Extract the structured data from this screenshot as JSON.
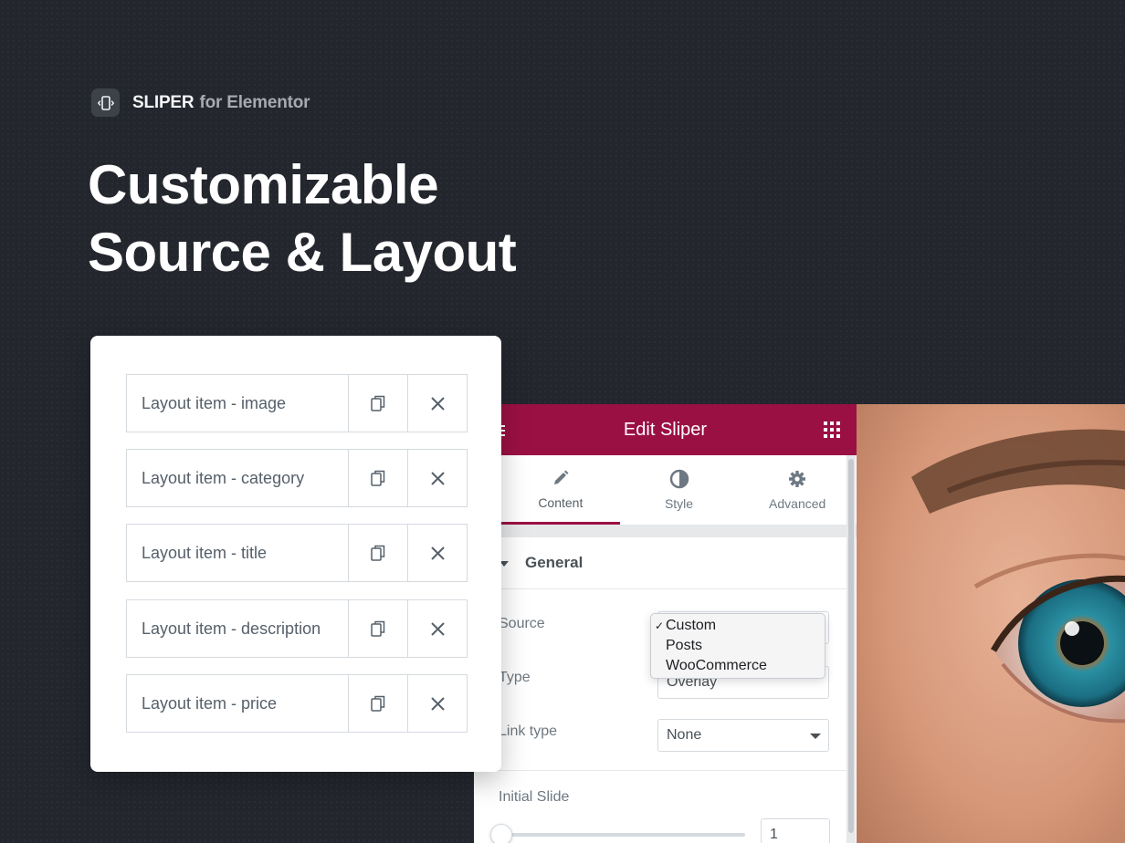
{
  "brand": {
    "name": "SLIPER",
    "suffix": "for Elementor"
  },
  "headline": {
    "line1": "Customizable",
    "line2": "Source & Layout"
  },
  "layout_items": [
    {
      "label": "Layout item - image"
    },
    {
      "label": "Layout item - category"
    },
    {
      "label": "Layout item - title"
    },
    {
      "label": "Layout item - description"
    },
    {
      "label": "Layout item - price"
    }
  ],
  "editor": {
    "title": "Edit Sliper",
    "tabs": [
      {
        "label": "Content",
        "icon": "pencil-icon",
        "active": true
      },
      {
        "label": "Style",
        "icon": "half-circle-icon",
        "active": false
      },
      {
        "label": "Advanced",
        "icon": "gear-icon",
        "active": false
      }
    ],
    "section_title": "General",
    "fields": {
      "source_label": "Source",
      "type_label": "Type",
      "type_value": "Overlay",
      "link_type_label": "Link type",
      "link_type_value": "None",
      "initial_slide_label": "Initial Slide",
      "initial_slide_value": "1"
    },
    "source_options": [
      {
        "label": "Custom",
        "checked": true
      },
      {
        "label": "Posts",
        "checked": false
      },
      {
        "label": "WooCommerce",
        "checked": false
      }
    ]
  },
  "colors": {
    "background": "#23262d",
    "accent": "#9b1043",
    "eye_iris": "#1f7f93"
  }
}
